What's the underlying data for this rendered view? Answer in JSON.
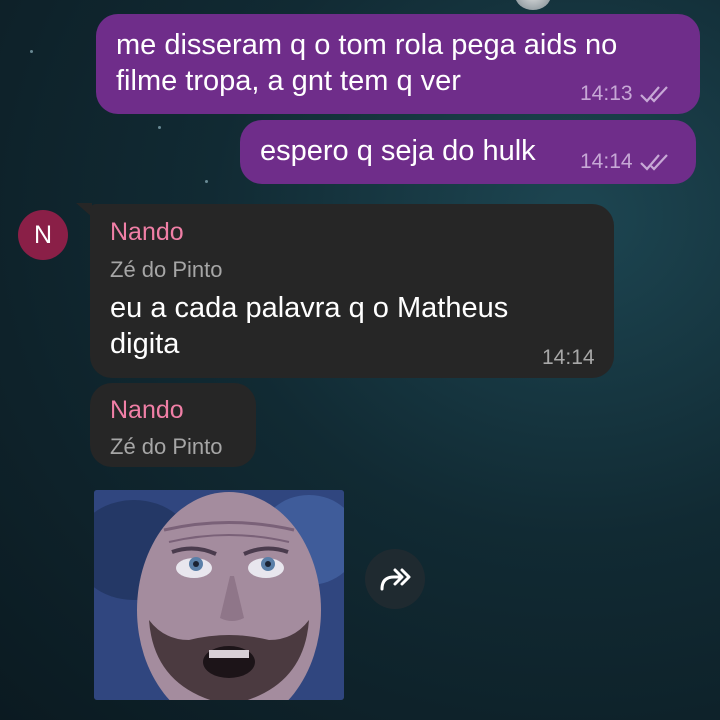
{
  "messages": [
    {
      "text": "me disseram q o tom rola pega aids no\nfilme tropa, a gnt tem q ver",
      "time": "14:13",
      "direction": "outgoing",
      "status_icon": "double-check-icon"
    },
    {
      "text": "espero q seja do hulk",
      "time": "14:14",
      "direction": "outgoing",
      "status_icon": "double-check-icon"
    },
    {
      "sender": "Nando",
      "forwarded_from": "Zé do Pinto",
      "text": "eu a cada palavra q o Matheus\ndigita",
      "time": "14:14",
      "direction": "incoming"
    },
    {
      "sender": "Nando",
      "forwarded_from": "Zé do Pinto",
      "media": "sticker-image",
      "direction": "incoming"
    }
  ],
  "avatar": {
    "initial": "N",
    "color": "#8a1f47"
  },
  "colors": {
    "outgoing_bubble": "#6f2d8a",
    "incoming_bubble": "#262626",
    "sender_name": "#f07fa6"
  },
  "share_icon": "forward-share-icon"
}
